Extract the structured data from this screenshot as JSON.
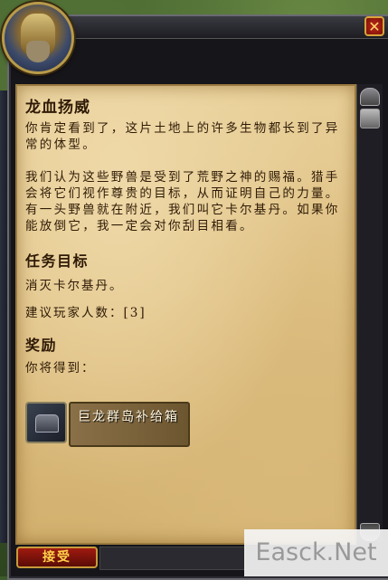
{
  "quest": {
    "title": "龙血扬威",
    "description_1": "你肯定看到了，这片土地上的许多生物都长到了异常的体型。",
    "description_2": "我们认为这些野兽是受到了荒野之神的赐福。猎手会将它们视作尊贵的目标，从而证明自己的力量。有一头野兽就在附近，我们叫它卡尔基丹。如果你能放倒它，我一定会对你刮目相看。",
    "objectives_heading": "任务目标",
    "objective_text": "消灭卡尔基丹。",
    "suggested_players": "建议玩家人数：[3]",
    "rewards_heading": "奖励",
    "rewards_intro": "你将得到：",
    "reward_item": "巨龙群岛补给箱"
  },
  "buttons": {
    "close": "✕",
    "accept": "接受"
  },
  "icons": {
    "portrait": "npc-portrait-icon",
    "reward": "supply-chest-icon"
  },
  "watermark": "Easck.Net",
  "colors": {
    "title_text": "#2e1a06",
    "accept_text": "#ffd24a",
    "parchment": "#e8cf98"
  }
}
